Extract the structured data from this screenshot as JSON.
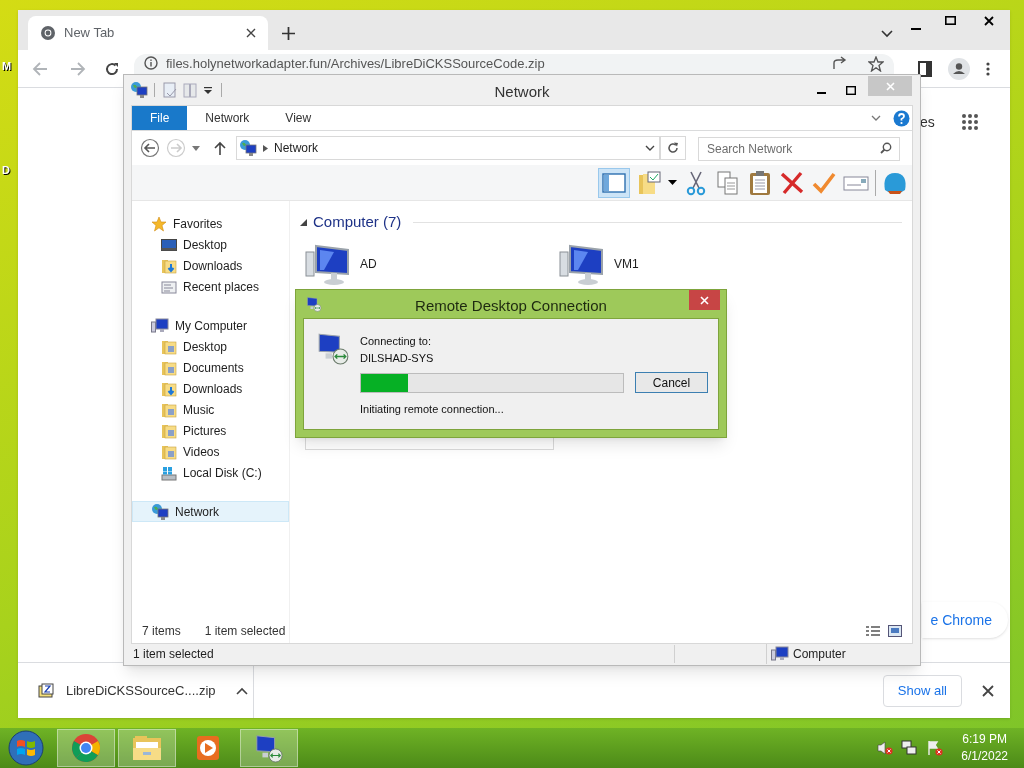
{
  "desktop": {
    "icon_labels": [
      "M",
      "D"
    ]
  },
  "browser": {
    "tabs": [
      {
        "title": "New Tab",
        "selected": true
      }
    ],
    "address": "files.holynetworkadapter.fun/Archives/LibreDiCKSSourceCode.zip",
    "page_link": "es",
    "page_button": "e Chrome",
    "downloads": [
      {
        "file": "LibreDiCKSSourceC....zip"
      }
    ],
    "show_all": "Show all"
  },
  "explorer": {
    "title": "Network",
    "ribbon_tabs": [
      {
        "label": "File",
        "selected": true
      },
      {
        "label": "Network",
        "selected": false
      },
      {
        "label": "View",
        "selected": false
      }
    ],
    "breadcrumb": [
      "Network"
    ],
    "search": {
      "placeholder": "Search Network"
    },
    "nav": [
      {
        "label": "Favorites",
        "kind": "star",
        "selected": false,
        "children": [
          {
            "label": "Desktop",
            "kind": "desktop",
            "selected": false
          },
          {
            "label": "Downloads",
            "kind": "download",
            "selected": false
          },
          {
            "label": "Recent places",
            "kind": "recent",
            "selected": false
          }
        ]
      },
      {
        "label": "My Computer",
        "kind": "computer",
        "selected": false,
        "children": [
          {
            "label": "Desktop",
            "kind": "folder",
            "selected": false
          },
          {
            "label": "Documents",
            "kind": "folder",
            "selected": false
          },
          {
            "label": "Downloads",
            "kind": "download",
            "selected": false
          },
          {
            "label": "Music",
            "kind": "folder",
            "selected": false
          },
          {
            "label": "Pictures",
            "kind": "folder",
            "selected": false
          },
          {
            "label": "Videos",
            "kind": "folder",
            "selected": false
          },
          {
            "label": "Local Disk (C:)",
            "kind": "disk",
            "selected": false
          }
        ]
      },
      {
        "label": "Network",
        "kind": "network",
        "selected": true
      }
    ],
    "group": {
      "title": "Computer (7)"
    },
    "items": [
      {
        "name": "AD"
      },
      {
        "name": "VM1"
      }
    ],
    "status": {
      "count": "7 items",
      "selection": "1 item selected"
    },
    "details_bar": {
      "selection": "1 item selected",
      "zone": "Computer"
    }
  },
  "dialog": {
    "title": "Remote Desktop Connection",
    "prompt": "Connecting to:",
    "host": "DILSHAD-SYS",
    "progress": {
      "level": 0.18
    },
    "status": "Initiating remote connection...",
    "cancel": "Cancel"
  },
  "taskbar": {
    "apps": [
      {
        "kind": "chrome",
        "running": true
      },
      {
        "kind": "explorer",
        "running": true
      },
      {
        "kind": "media",
        "running": false
      },
      {
        "kind": "rdc",
        "running": true
      }
    ],
    "time": "6:19 PM",
    "date": "6/1/2022"
  }
}
